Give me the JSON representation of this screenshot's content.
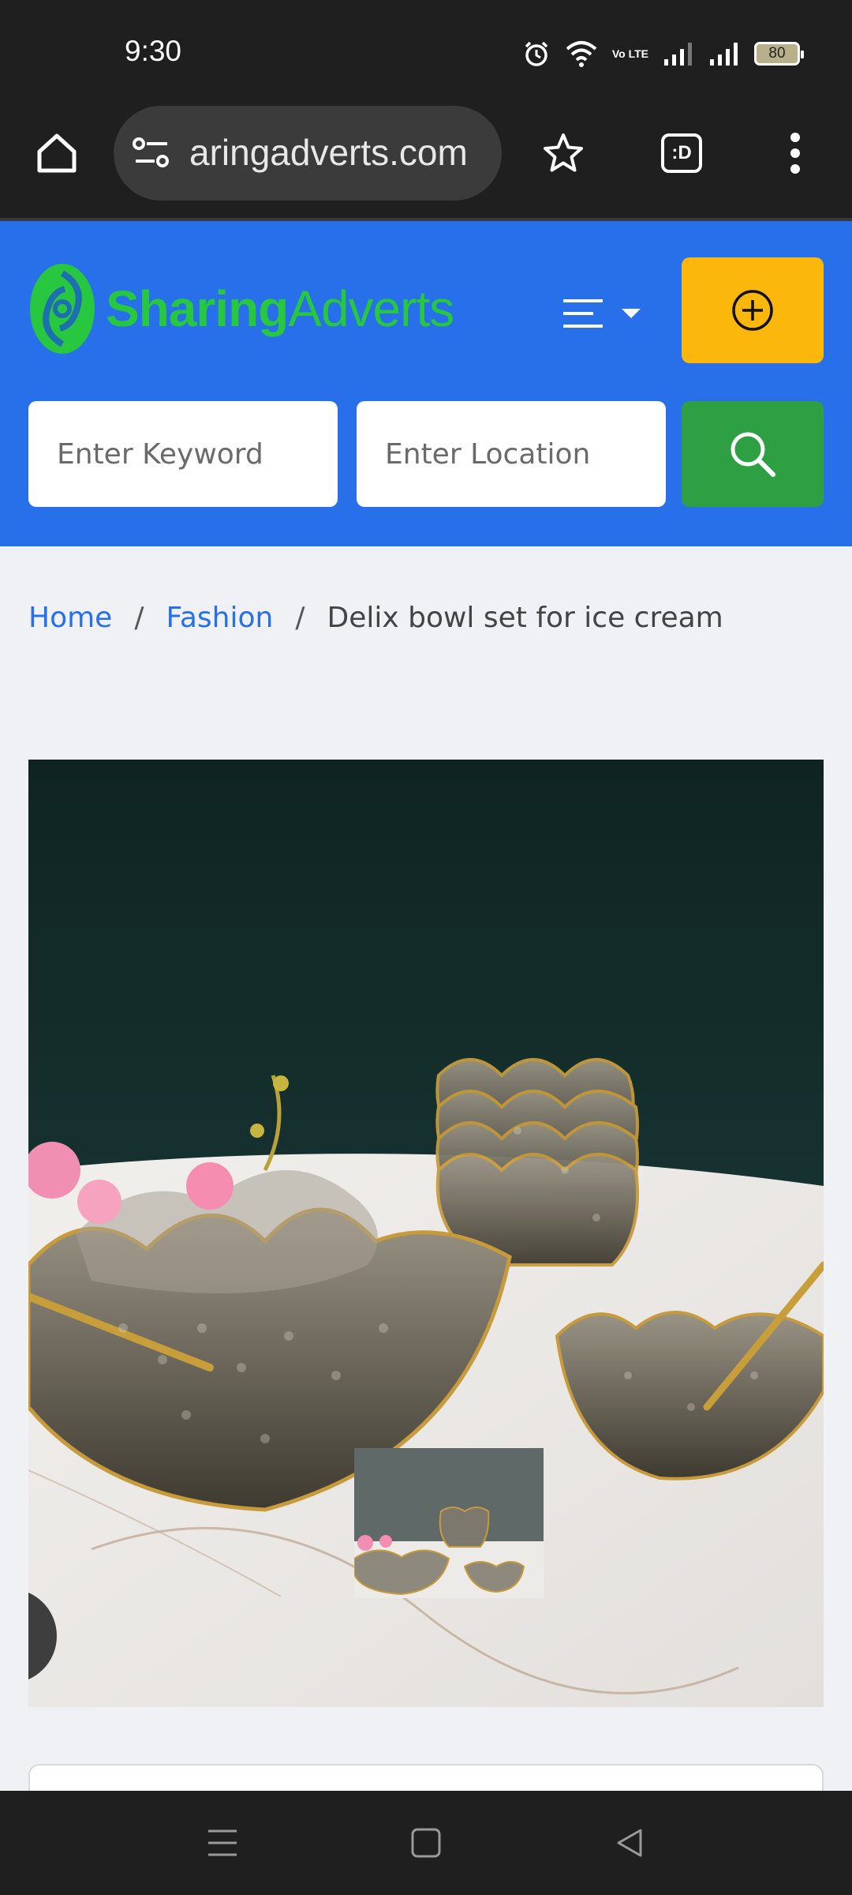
{
  "status_bar": {
    "time": "9:30",
    "volte_label": "Vo LTE",
    "battery_level": "80"
  },
  "browser": {
    "url": "aringadverts.com",
    "tab_switcher_label": ":D"
  },
  "site": {
    "logo_text_bold": "Sharing",
    "logo_text_regular": "Adverts",
    "keyword_placeholder": "Enter Keyword",
    "location_placeholder": "Enter Location",
    "colors": {
      "header_blue": "#2770ea",
      "post_button_yellow": "#fbb70b",
      "search_button_green": "#2ea043",
      "logo_green": "#27c83f"
    }
  },
  "breadcrumb": {
    "home": "Home",
    "category": "Fashion",
    "separator": "/",
    "current": "Delix bowl set for ice cream"
  }
}
